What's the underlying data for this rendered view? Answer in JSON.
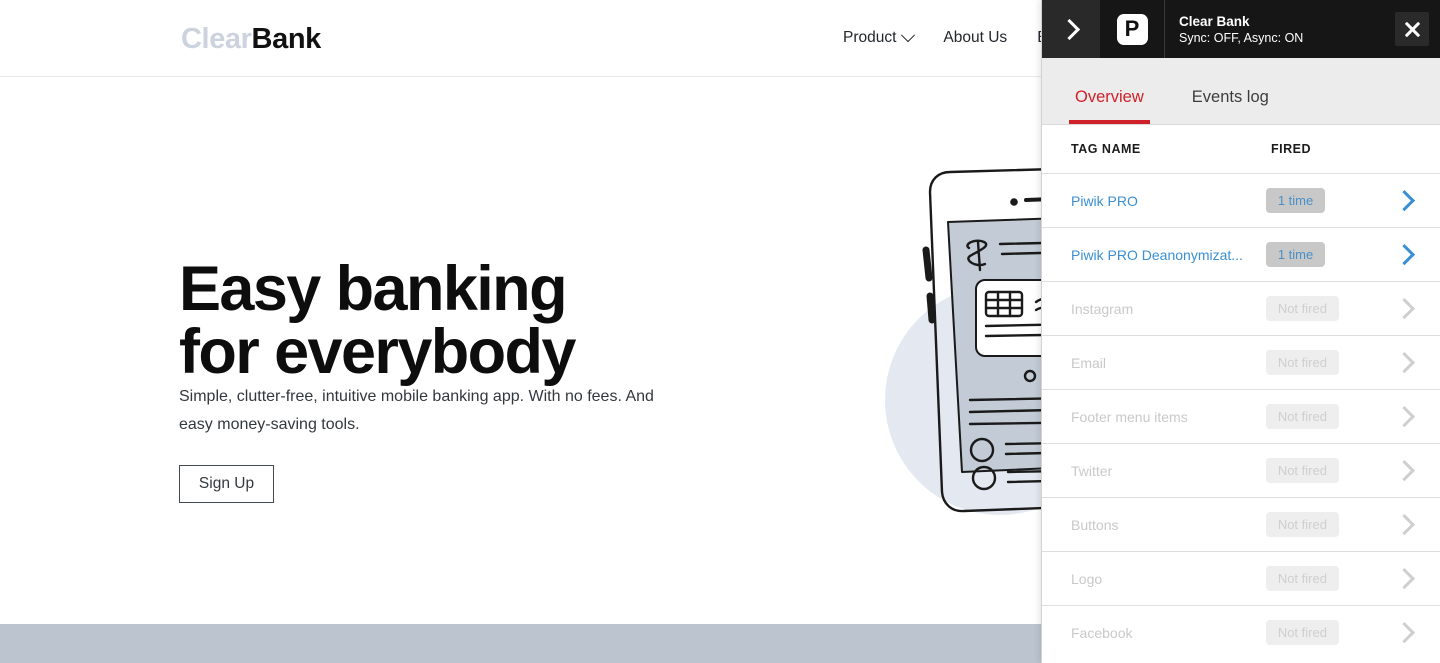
{
  "site": {
    "logo": {
      "part1": "Clear",
      "part2": "Bank",
      "color1": "#ccd3df",
      "color2": "#111111"
    },
    "nav": [
      {
        "label": "Product",
        "has_caret": true
      },
      {
        "label": "About Us",
        "has_caret": false
      },
      {
        "label": "B",
        "has_caret": false
      }
    ],
    "hero": {
      "title": "Easy banking\nfor everybody",
      "subtitle": "Simple, clutter-free, intuitive mobile banking app. With no fees. And easy money-saving tools.",
      "cta_label": "Sign Up"
    },
    "footer_color": "#bcc4d0"
  },
  "panel": {
    "toggle_icon": "chevron-right-icon",
    "logo_letter": "P",
    "site_name": "Clear Bank",
    "sync_state": "Sync: OFF,  Async: ON",
    "close_icon": "close-icon",
    "accent_color": "#d0212a",
    "link_color": "#3a8fd4",
    "tabs": [
      {
        "label": "Overview",
        "active": true
      },
      {
        "label": "Events log",
        "active": false
      }
    ],
    "table": {
      "columns": [
        "TAG NAME",
        "FIRED"
      ],
      "rows": [
        {
          "name": "Piwik PRO",
          "fired": "1 time",
          "is_fired": true
        },
        {
          "name": "Piwik PRO Deanonymizat...",
          "fired": "1 time",
          "is_fired": true
        },
        {
          "name": "Instagram",
          "fired": "Not fired",
          "is_fired": false
        },
        {
          "name": "Email",
          "fired": "Not fired",
          "is_fired": false
        },
        {
          "name": "Footer menu items",
          "fired": "Not fired",
          "is_fired": false
        },
        {
          "name": "Twitter",
          "fired": "Not fired",
          "is_fired": false
        },
        {
          "name": "Buttons",
          "fired": "Not fired",
          "is_fired": false
        },
        {
          "name": "Logo",
          "fired": "Not fired",
          "is_fired": false
        },
        {
          "name": "Facebook",
          "fired": "Not fired",
          "is_fired": false
        }
      ]
    }
  }
}
